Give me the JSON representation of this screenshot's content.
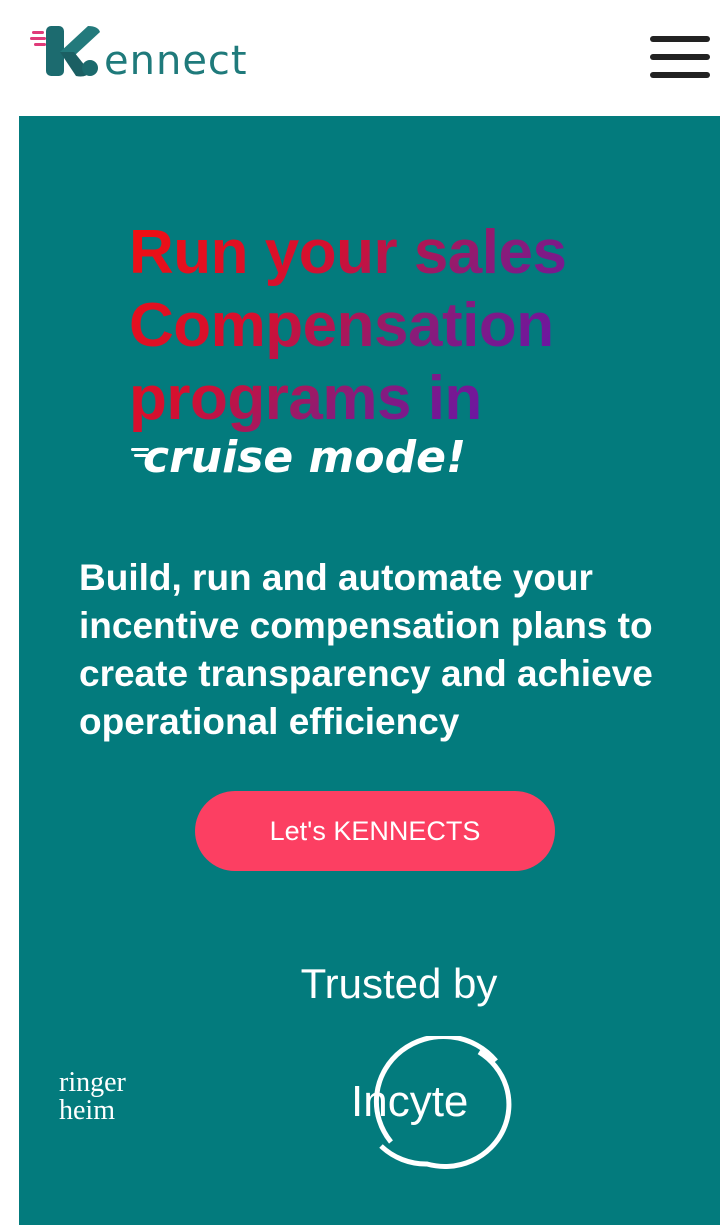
{
  "header": {
    "brand": "ennect",
    "menu_icon": "hamburger-menu-icon"
  },
  "hero": {
    "headline_lines": [
      "Run your sales",
      "Compensation",
      "programs in"
    ],
    "tagline": "cruise mode!",
    "subtext_lines": [
      "Build, run and automate your",
      "incentive compensation plans to",
      "create transparency and achieve",
      "operational efficiency"
    ],
    "cta_label": "Let's KENNECTS",
    "trusted_label": "Trusted by",
    "partial_logo_lines": [
      "ringer",
      "heim"
    ],
    "incyte_logo_text": "Incyte"
  },
  "colors": {
    "brand_teal": "#037b7d",
    "cta_pink": "#fc3f62",
    "headline_gradient": [
      "#f20f10",
      "#5513c0"
    ]
  }
}
